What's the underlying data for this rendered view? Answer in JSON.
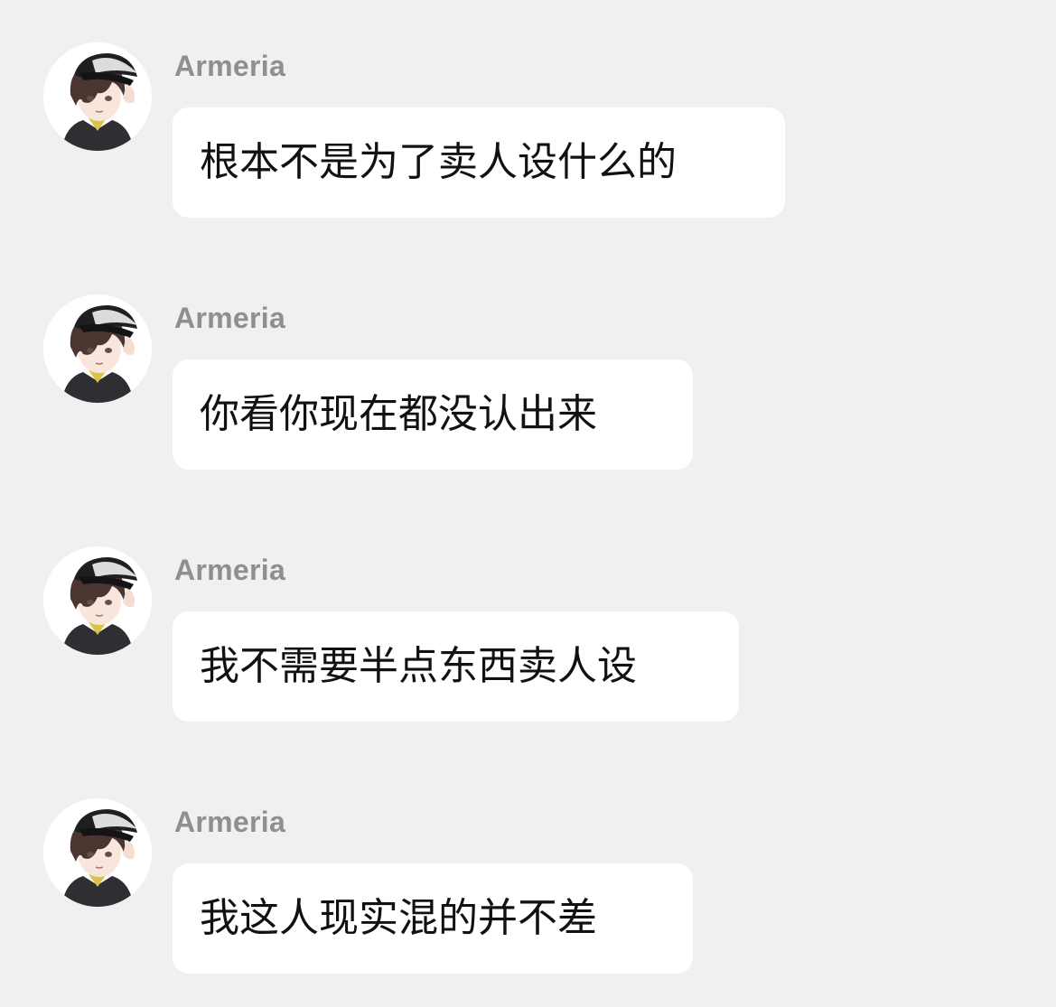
{
  "chat": {
    "messages": [
      {
        "sender": "Armeria",
        "text": "根本不是为了卖人设什么的",
        "avatar_icon": "anime-avatar-icon"
      },
      {
        "sender": "Armeria",
        "text": "你看你现在都没认出来",
        "avatar_icon": "anime-avatar-icon"
      },
      {
        "sender": "Armeria",
        "text": "我不需要半点东西卖人设",
        "avatar_icon": "anime-avatar-icon"
      },
      {
        "sender": "Armeria",
        "text": "我这人现实混的并不差",
        "avatar_icon": "anime-avatar-icon"
      }
    ]
  },
  "colors": {
    "background": "#f0f0f0",
    "bubble": "#ffffff",
    "sender_name": "#8f8f8f",
    "message_text": "#111111"
  }
}
